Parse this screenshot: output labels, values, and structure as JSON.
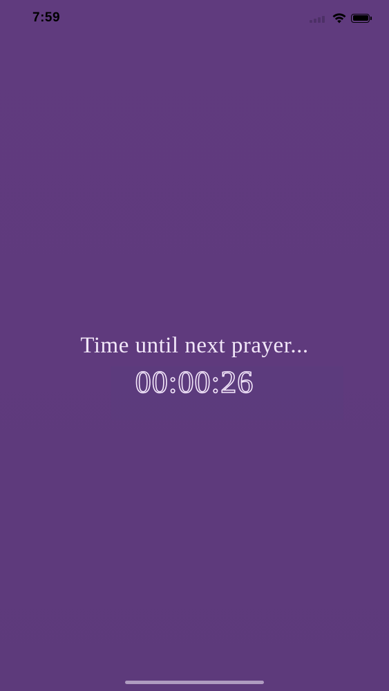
{
  "status_bar": {
    "time": "7:59",
    "icons": [
      "signal-icon",
      "wifi-icon",
      "battery-icon"
    ]
  },
  "countdown": {
    "label": "Time until next prayer...",
    "timer": "00:00:26"
  },
  "colors": {
    "background": "#5e3a7c",
    "text": "#f1e6f8"
  }
}
